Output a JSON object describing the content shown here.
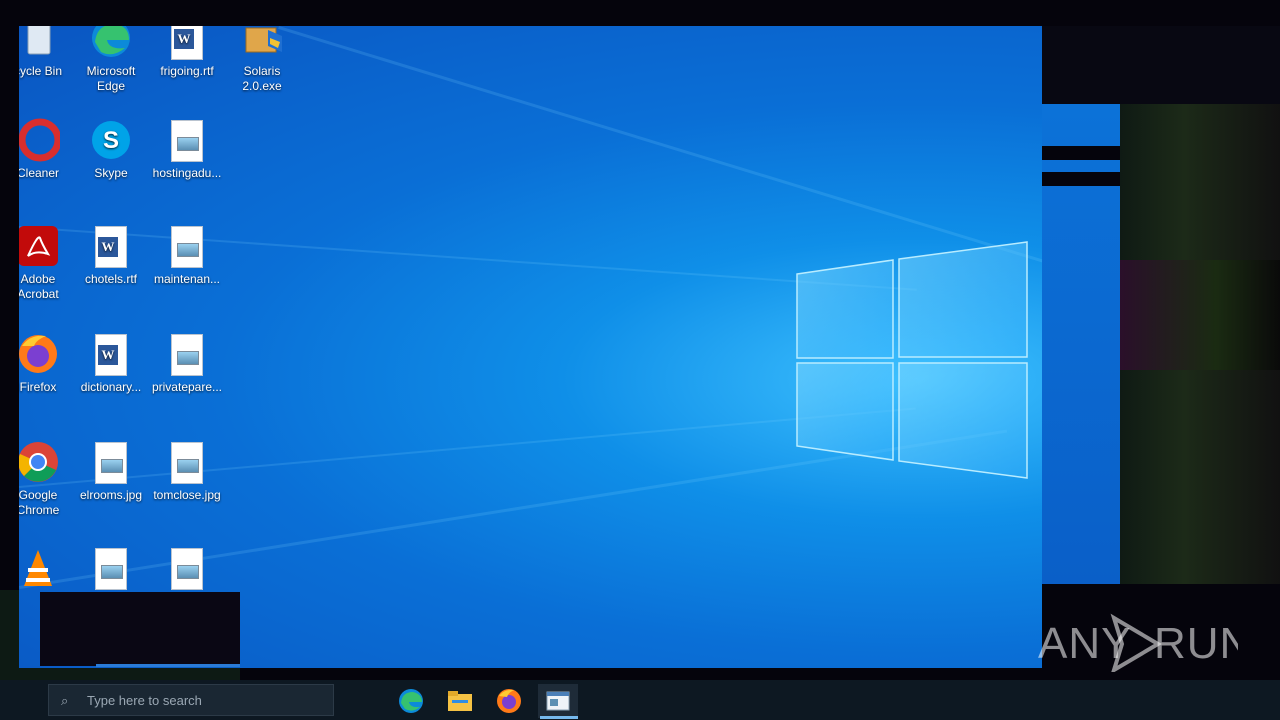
{
  "desktop": {
    "icons": [
      {
        "id": "recycle-bin",
        "label": "cycle Bin",
        "kind": "recycle"
      },
      {
        "id": "microsoft-edge",
        "label": "Microsoft Edge",
        "kind": "edge"
      },
      {
        "id": "frigoing",
        "label": "frigoing.rtf",
        "kind": "word"
      },
      {
        "id": "solaris",
        "label": "Solaris 2.0.exe",
        "kind": "installer"
      },
      {
        "id": "ccleaner",
        "label": "Cleaner",
        "kind": "ccleaner"
      },
      {
        "id": "skype",
        "label": "Skype",
        "kind": "skype"
      },
      {
        "id": "hostingadu",
        "label": "hostingadu...",
        "kind": "image"
      },
      {
        "id": "adobe-acrobat",
        "label": "Adobe Acrobat",
        "kind": "acrobat"
      },
      {
        "id": "chotels",
        "label": "chotels.rtf",
        "kind": "word"
      },
      {
        "id": "maintenan",
        "label": "maintenan...",
        "kind": "image"
      },
      {
        "id": "firefox",
        "label": "Firefox",
        "kind": "firefox"
      },
      {
        "id": "dictionary",
        "label": "dictionary...",
        "kind": "word"
      },
      {
        "id": "privatepare",
        "label": "privatepare...",
        "kind": "image"
      },
      {
        "id": "google-chrome",
        "label": "Google Chrome",
        "kind": "chrome"
      },
      {
        "id": "elrooms",
        "label": "elrooms.jpg",
        "kind": "image"
      },
      {
        "id": "tomclose",
        "label": "tomclose.jpg",
        "kind": "image"
      },
      {
        "id": "vlc",
        "label": "",
        "kind": "vlc"
      },
      {
        "id": "img-row6-a",
        "label": "",
        "kind": "image"
      },
      {
        "id": "img-row6-b",
        "label": "",
        "kind": "image"
      }
    ]
  },
  "taskbar": {
    "search_placeholder": "Type here to search",
    "pinned": [
      "edge-icon",
      "file-explorer-icon",
      "firefox-icon",
      "app-window-icon"
    ],
    "active": "app-window-icon"
  },
  "watermark": {
    "text_left": "ANY",
    "text_right": "RUN"
  },
  "colors": {
    "desktop_blue": "#0a6fd6",
    "taskbar": "#0d1822",
    "accent": "#76b9ed"
  }
}
